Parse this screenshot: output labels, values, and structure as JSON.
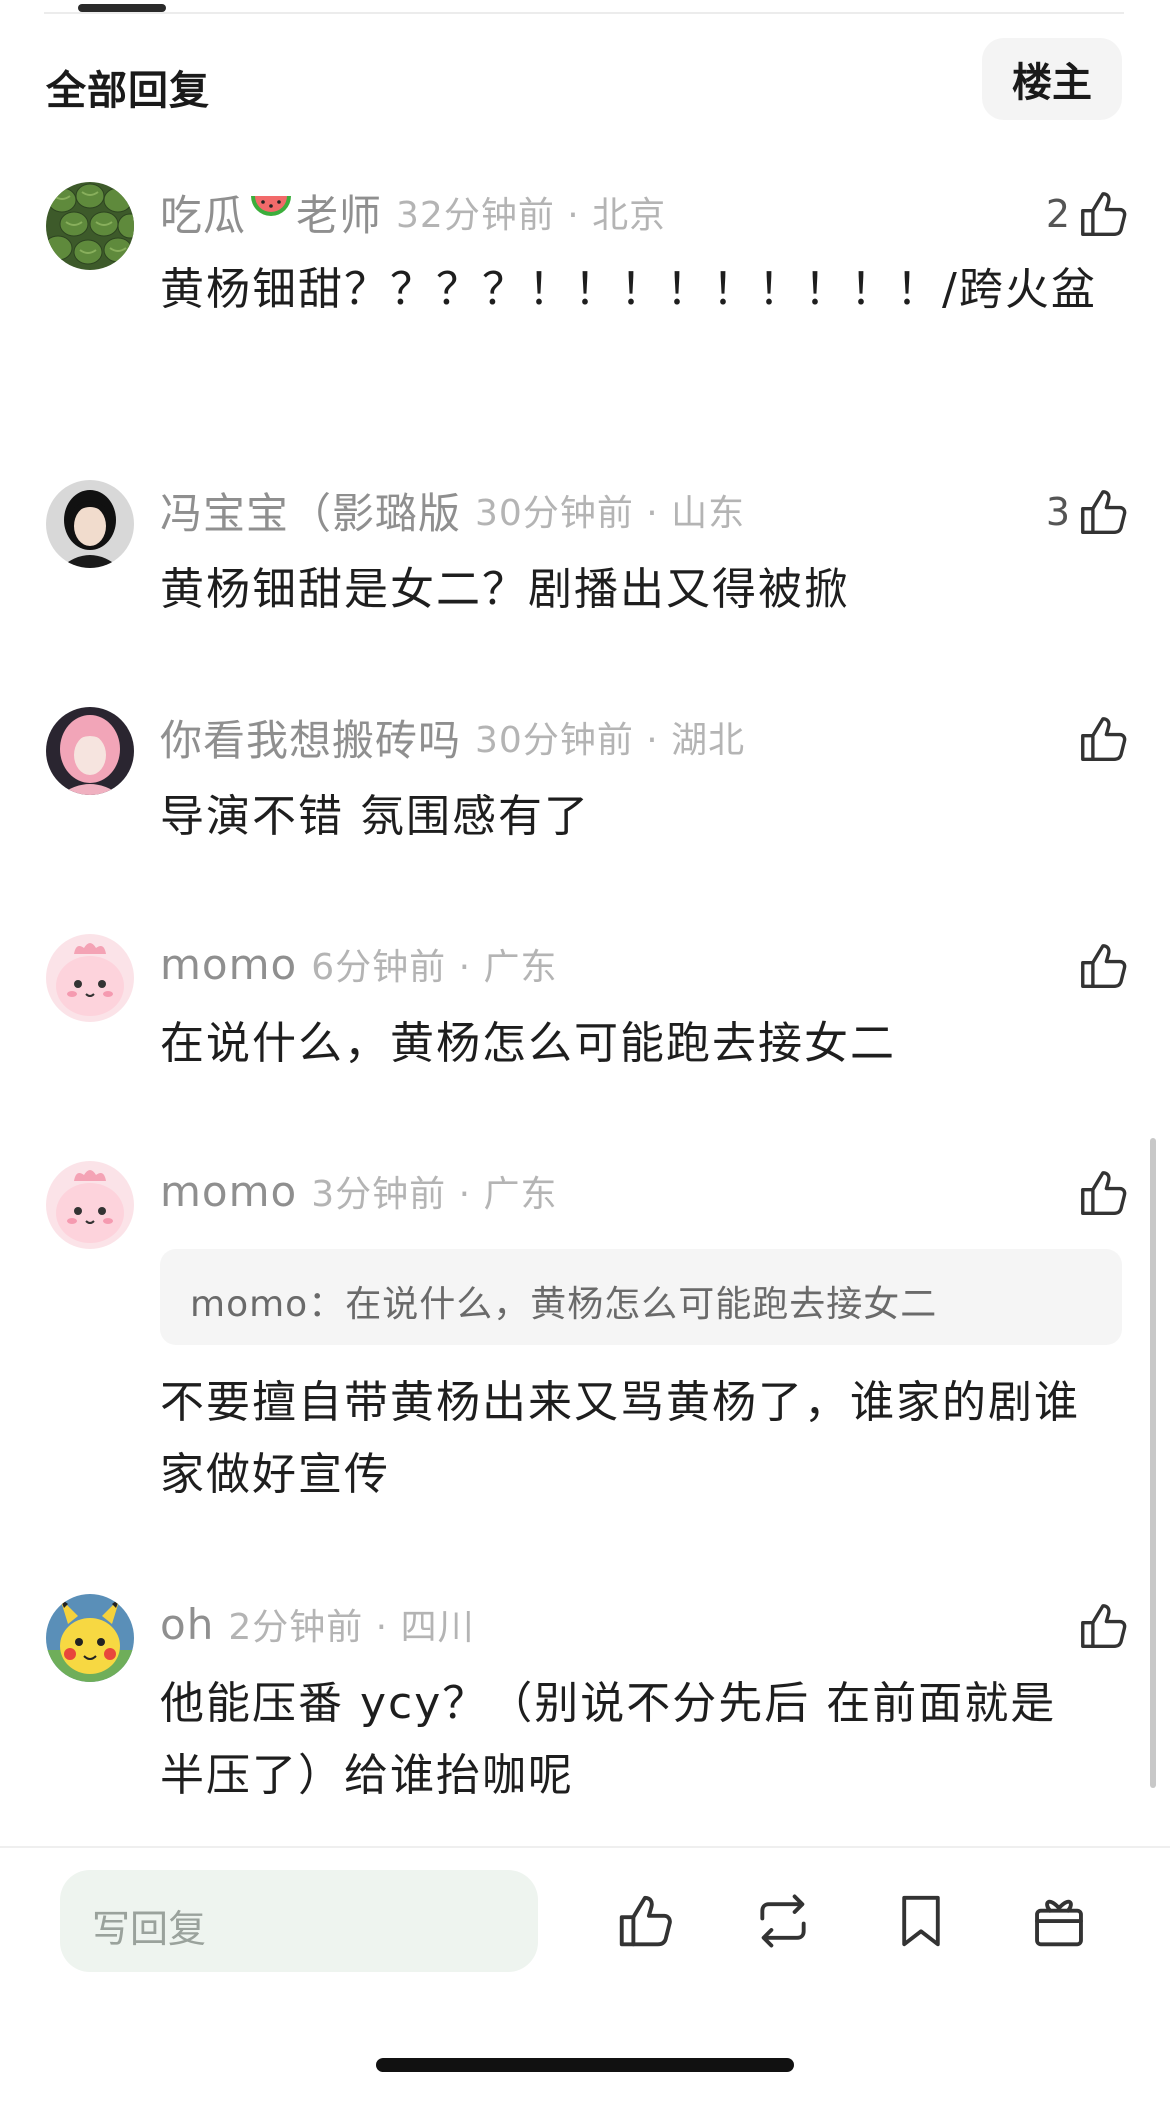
{
  "header": {
    "title": "全部回复",
    "op_button": "楼主"
  },
  "comments": [
    {
      "user": "吃瓜",
      "user_emoji": "watermelon-icon",
      "user_suffix": "老师",
      "time": "32分钟前 · 北京",
      "likes": "2",
      "text": "黄杨钿甜？？？？！！！！！！！！！/跨火盆"
    },
    {
      "user": "冯宝宝（影璐版",
      "time": "30分钟前 · 山东",
      "likes": "3",
      "text": "黄杨钿甜是女二？剧播出又得被掀"
    },
    {
      "user": "你看我想搬砖吗",
      "time": "30分钟前 · 湖北",
      "likes": "",
      "text": "导演不错 氛围感有了"
    },
    {
      "user": "momo",
      "time": "6分钟前 · 广东",
      "likes": "",
      "text": "在说什么，黄杨怎么可能跑去接女二"
    },
    {
      "user": "momo",
      "time": "3分钟前 · 广东",
      "likes": "",
      "quote": "momo：在说什么，黄杨怎么可能跑去接女二",
      "text": "不要擅自带黄杨出来又骂黄杨了，谁家的剧谁家做好宣传"
    },
    {
      "user": "oh",
      "time": "2分钟前 · 四川",
      "likes": "",
      "text": "他能压番 ycy？（别说不分先后 在前面就是半压了）给谁抬咖呢"
    }
  ],
  "bottom_bar": {
    "reply_placeholder": "写回复",
    "actions": [
      "like-icon",
      "repost-icon",
      "bookmark-icon",
      "gift-icon"
    ]
  }
}
